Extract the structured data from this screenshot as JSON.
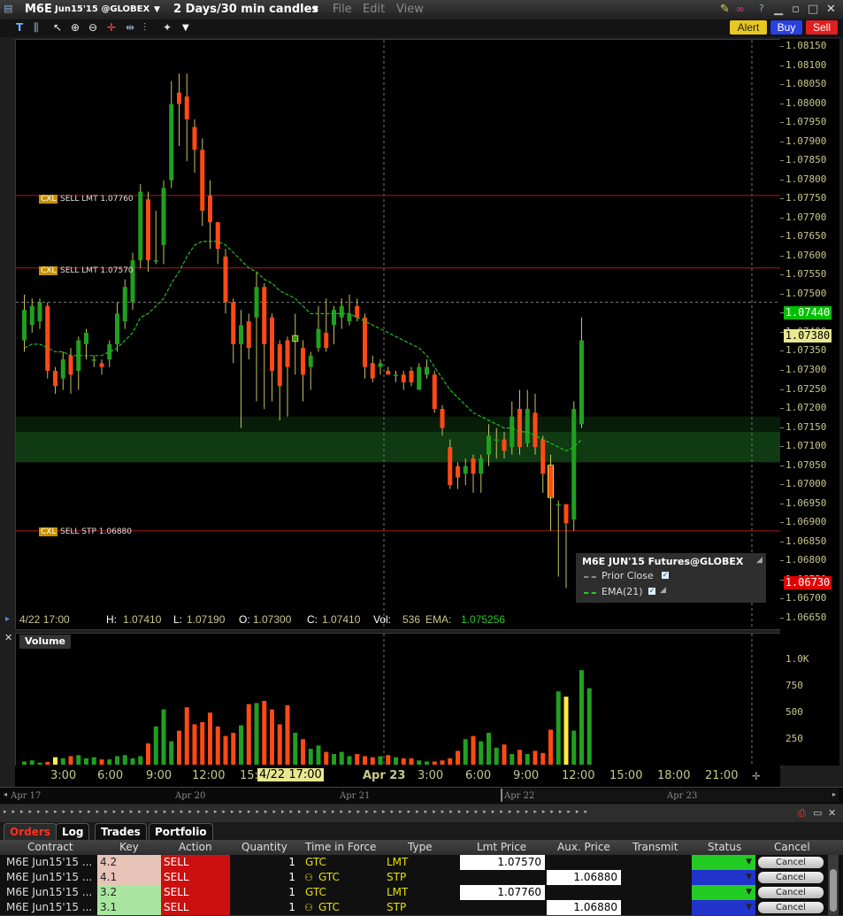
{
  "window": {
    "symbol": "M6E",
    "contract": "Jun15'15 @GLOBEX",
    "timeframe": "2 Days/30 min candles",
    "menu": [
      "File",
      "Edit",
      "View"
    ]
  },
  "header_buttons": {
    "alert": "Alert",
    "buy": "Buy",
    "sell": "Sell"
  },
  "price_axis": [
    "1.08150",
    "1.08100",
    "1.08050",
    "1.08000",
    "1.07950",
    "1.07900",
    "1.07850",
    "1.07800",
    "1.07750",
    "1.07700",
    "1.07650",
    "1.07600",
    "1.07550",
    "1.07500",
    "1.07450",
    "1.07400",
    "1.07350",
    "1.07300",
    "1.07250",
    "1.07200",
    "1.07150",
    "1.07100",
    "1.07050",
    "1.07000",
    "1.06950",
    "1.06900",
    "1.06850",
    "1.06800",
    "1.06750",
    "1.06700",
    "1.06650"
  ],
  "price_markers": {
    "last": "1.07440",
    "cursor": "1.07380",
    "stop": "1.06730"
  },
  "orders_on_chart": [
    {
      "tag": "CXL",
      "label": "SELL LMT 1.07760"
    },
    {
      "tag": "CXL",
      "label": "SELL LMT 1.07570"
    },
    {
      "tag": "CXL",
      "label": "SELL STP 1.06880"
    }
  ],
  "legend": {
    "title": "M6E JUN'15 Futures@GLOBEX",
    "items": [
      "Prior Close",
      "EMA(21)"
    ]
  },
  "info_line": {
    "time": "4/22 17:00",
    "h_label": "H:",
    "h": "1.07410",
    "l_label": "L:",
    "l": "1.07190",
    "o_label": "O:",
    "o": "1.07300",
    "c_label": "C:",
    "c": "1.07410",
    "vol_label": "Vol:",
    "vol": "536",
    "ema_label": "EMA:",
    "ema": "1.075256"
  },
  "volume_panel": {
    "title": "Volume",
    "axis": [
      "1.0K",
      "750",
      "500",
      "250"
    ]
  },
  "time_axis": [
    "3:00",
    "6:00",
    "9:00",
    "12:00",
    "15:",
    "4/22 17:00",
    "Apr 23",
    "3:00",
    "6:00",
    "9:00",
    "12:00",
    "15:00",
    "18:00",
    "21:00"
  ],
  "nav_dates": [
    "Apr 17",
    "Apr 20",
    "Apr 21",
    "Apr 22",
    "Apr 23"
  ],
  "tabs": [
    "Orders",
    "Log",
    "Trades",
    "Portfolio"
  ],
  "order_columns": [
    "Contract",
    "Key",
    "Action",
    "Quantity",
    "Time in Force",
    "Type",
    "Lmt Price",
    "Aux. Price",
    "Transmit",
    "Status",
    "Cancel"
  ],
  "orders": [
    {
      "contract": "M6E Jun15'15 ...",
      "key": "4.2",
      "action": "SELL",
      "qty": "1",
      "tif": "GTC",
      "type": "LMT",
      "lmt": "1.07570",
      "aux": "",
      "cancel": "Cancel",
      "status_color": "#22cc22",
      "key_color": "#e8c4b8"
    },
    {
      "contract": "M6E Jun15'15 ...",
      "key": "4.1",
      "action": "SELL",
      "qty": "1",
      "tif": "GTC",
      "type": "STP",
      "lmt": "",
      "aux": "1.06880",
      "cancel": "Cancel",
      "status_color": "#2233cc",
      "key_color": "#e8c4b8"
    },
    {
      "contract": "M6E Jun15'15 ...",
      "key": "3.2",
      "action": "SELL",
      "qty": "1",
      "tif": "GTC",
      "type": "LMT",
      "lmt": "1.07760",
      "aux": "",
      "cancel": "Cancel",
      "status_color": "#22cc22",
      "key_color": "#a8e6a0"
    },
    {
      "contract": "M6E Jun15'15 ...",
      "key": "3.1",
      "action": "SELL",
      "qty": "1",
      "tif": "GTC",
      "type": "STP",
      "lmt": "",
      "aux": "1.06880",
      "cancel": "Cancel",
      "status_color": "#2233cc",
      "key_color": "#a8e6a0"
    }
  ],
  "colors": {
    "up": "#1fa01f",
    "down": "#ff4a14",
    "ema": "#22bb22",
    "order_line": "#b01818",
    "axis_text": "#c8c88c"
  },
  "chart_data": {
    "type": "candlestick",
    "ylim": [
      1.0663,
      1.0818
    ],
    "ema_period": 21,
    "lines": {
      "sell_lmt_1": 1.0776,
      "sell_lmt_2": 1.0757,
      "sell_stp": 1.0688,
      "prior_close": 1.0748
    },
    "candles": [
      {
        "o": 1.0738,
        "c": 1.0746,
        "h": 1.075,
        "l": 1.0735
      },
      {
        "o": 1.0742,
        "c": 1.0747,
        "h": 1.0749,
        "l": 1.074
      },
      {
        "o": 1.0743,
        "c": 1.0748,
        "h": 1.0749,
        "l": 1.0741
      },
      {
        "o": 1.0747,
        "c": 1.073,
        "h": 1.0748,
        "l": 1.0728
      },
      {
        "o": 1.073,
        "c": 1.0726,
        "h": 1.0731,
        "l": 1.0724
      },
      {
        "o": 1.0728,
        "c": 1.0733,
        "h": 1.0735,
        "l": 1.0725
      },
      {
        "o": 1.0734,
        "c": 1.0729,
        "h": 1.0736,
        "l": 1.0724
      },
      {
        "o": 1.073,
        "c": 1.0738,
        "h": 1.0739,
        "l": 1.0725
      },
      {
        "o": 1.0737,
        "c": 1.074,
        "h": 1.0741,
        "l": 1.0733
      },
      {
        "o": 1.0733,
        "c": 1.0733,
        "h": 1.0734,
        "l": 1.0731
      },
      {
        "o": 1.0732,
        "c": 1.0731,
        "h": 1.0733,
        "l": 1.0729
      },
      {
        "o": 1.0733,
        "c": 1.0737,
        "h": 1.0738,
        "l": 1.0731
      },
      {
        "o": 1.0737,
        "c": 1.0745,
        "h": 1.0748,
        "l": 1.0735
      },
      {
        "o": 1.0743,
        "c": 1.0752,
        "h": 1.0754,
        "l": 1.0741
      },
      {
        "o": 1.0748,
        "c": 1.0759,
        "h": 1.0761,
        "l": 1.0746
      },
      {
        "o": 1.0759,
        "c": 1.0777,
        "h": 1.0779,
        "l": 1.0757
      },
      {
        "o": 1.0775,
        "c": 1.0759,
        "h": 1.0777,
        "l": 1.0756
      },
      {
        "o": 1.0759,
        "c": 1.0759,
        "h": 1.0772,
        "l": 1.0758
      },
      {
        "o": 1.0763,
        "c": 1.0778,
        "h": 1.078,
        "l": 1.0758
      },
      {
        "o": 1.078,
        "c": 1.08,
        "h": 1.0806,
        "l": 1.0778
      },
      {
        "o": 1.0803,
        "c": 1.08,
        "h": 1.0808,
        "l": 1.0789
      },
      {
        "o": 1.0802,
        "c": 1.0796,
        "h": 1.0808,
        "l": 1.0785
      },
      {
        "o": 1.0794,
        "c": 1.0788,
        "h": 1.0796,
        "l": 1.0782
      },
      {
        "o": 1.0788,
        "c": 1.0772,
        "h": 1.0791,
        "l": 1.0768
      },
      {
        "o": 1.0776,
        "c": 1.0769,
        "h": 1.078,
        "l": 1.0762
      },
      {
        "o": 1.0769,
        "c": 1.0762,
        "h": 1.0769,
        "l": 1.0758
      },
      {
        "o": 1.076,
        "c": 1.0748,
        "h": 1.0762,
        "l": 1.0745
      },
      {
        "o": 1.0748,
        "c": 1.0737,
        "h": 1.0749,
        "l": 1.0732
      },
      {
        "o": 1.0737,
        "c": 1.0742,
        "h": 1.0746,
        "l": 1.0715
      },
      {
        "o": 1.0743,
        "c": 1.0736,
        "h": 1.0745,
        "l": 1.0733
      },
      {
        "o": 1.0744,
        "c": 1.0752,
        "h": 1.0756,
        "l": 1.0722
      },
      {
        "o": 1.0752,
        "c": 1.0737,
        "h": 1.0753,
        "l": 1.072
      },
      {
        "o": 1.0744,
        "c": 1.073,
        "h": 1.0745,
        "l": 1.0722
      },
      {
        "o": 1.0737,
        "c": 1.0726,
        "h": 1.0738,
        "l": 1.0717
      },
      {
        "o": 1.0738,
        "c": 1.0731,
        "h": 1.0739,
        "l": 1.0718
      },
      {
        "o": 1.0738,
        "c": 1.0739,
        "h": 1.0745,
        "l": 1.0729
      },
      {
        "o": 1.0736,
        "c": 1.0729,
        "h": 1.0738,
        "l": 1.0722
      },
      {
        "o": 1.0731,
        "c": 1.0734,
        "h": 1.0735,
        "l": 1.0725
      },
      {
        "o": 1.0736,
        "c": 1.0741,
        "h": 1.0747,
        "l": 1.0735
      },
      {
        "o": 1.074,
        "c": 1.0736,
        "h": 1.0749,
        "l": 1.0735
      },
      {
        "o": 1.0742,
        "c": 1.0746,
        "h": 1.0747,
        "l": 1.0737
      },
      {
        "o": 1.0744,
        "c": 1.0747,
        "h": 1.0749,
        "l": 1.0741
      },
      {
        "o": 1.0743,
        "c": 1.0745,
        "h": 1.075,
        "l": 1.0742
      },
      {
        "o": 1.0747,
        "c": 1.0744,
        "h": 1.0749,
        "l": 1.0743
      },
      {
        "o": 1.0744,
        "c": 1.0731,
        "h": 1.0745,
        "l": 1.0728
      },
      {
        "o": 1.0732,
        "c": 1.0728,
        "h": 1.0734,
        "l": 1.0727
      },
      {
        "o": 1.0731,
        "c": 1.0732,
        "h": 1.0733,
        "l": 1.0729
      },
      {
        "o": 1.073,
        "c": 1.0729,
        "h": 1.0731,
        "l": 1.0729
      },
      {
        "o": 1.0729,
        "c": 1.0729,
        "h": 1.073,
        "l": 1.0727
      },
      {
        "o": 1.0729,
        "c": 1.0727,
        "h": 1.073,
        "l": 1.0725
      },
      {
        "o": 1.073,
        "c": 1.0727,
        "h": 1.0731,
        "l": 1.0726
      },
      {
        "o": 1.0725,
        "c": 1.0731,
        "h": 1.0732,
        "l": 1.0725
      },
      {
        "o": 1.0729,
        "c": 1.0731,
        "h": 1.0733,
        "l": 1.0728
      },
      {
        "o": 1.0729,
        "c": 1.072,
        "h": 1.073,
        "l": 1.0719
      },
      {
        "o": 1.072,
        "c": 1.0715,
        "h": 1.0721,
        "l": 1.0713
      },
      {
        "o": 1.071,
        "c": 1.07,
        "h": 1.0712,
        "l": 1.0699
      },
      {
        "o": 1.0705,
        "c": 1.0702,
        "h": 1.0706,
        "l": 1.0699
      },
      {
        "o": 1.0703,
        "c": 1.0705,
        "h": 1.0707,
        "l": 1.07
      },
      {
        "o": 1.0707,
        "c": 1.0703,
        "h": 1.0708,
        "l": 1.0698
      },
      {
        "o": 1.0703,
        "c": 1.0707,
        "h": 1.0708,
        "l": 1.0698
      },
      {
        "o": 1.0708,
        "c": 1.0713,
        "h": 1.0716,
        "l": 1.0705
      },
      {
        "o": 1.0712,
        "c": 1.0712,
        "h": 1.0715,
        "l": 1.0707
      },
      {
        "o": 1.0712,
        "c": 1.0709,
        "h": 1.0714,
        "l": 1.0707
      },
      {
        "o": 1.071,
        "c": 1.0718,
        "h": 1.0722,
        "l": 1.0708
      },
      {
        "o": 1.072,
        "c": 1.071,
        "h": 1.0725,
        "l": 1.0708
      },
      {
        "o": 1.0711,
        "c": 1.072,
        "h": 1.0725,
        "l": 1.071
      },
      {
        "o": 1.0719,
        "c": 1.071,
        "h": 1.0724,
        "l": 1.0708
      },
      {
        "o": 1.0712,
        "c": 1.0703,
        "h": 1.0713,
        "l": 1.0698
      },
      {
        "o": 1.0705,
        "c": 1.0697,
        "h": 1.0708,
        "l": 1.0688
      },
      {
        "o": 1.0695,
        "c": 1.0695,
        "h": 1.0696,
        "l": 1.0676
      },
      {
        "o": 1.0695,
        "c": 1.069,
        "h": 1.0695,
        "l": 1.0673
      },
      {
        "o": 1.0691,
        "c": 1.072,
        "h": 1.0722,
        "l": 1.0688
      },
      {
        "o": 1.0716,
        "c": 1.0738,
        "h": 1.0744,
        "l": 1.0715
      }
    ],
    "ema": [
      1.0736,
      1.0737,
      1.0737,
      1.0736,
      1.0735,
      1.0735,
      1.0734,
      1.0734,
      1.0734,
      1.0734,
      1.0734,
      1.0735,
      1.0736,
      1.0738,
      1.074,
      1.0744,
      1.0745,
      1.0747,
      1.0749,
      1.0753,
      1.0756,
      1.076,
      1.0763,
      1.0764,
      1.0764,
      1.0764,
      1.0763,
      1.0761,
      1.0759,
      1.0757,
      1.0756,
      1.0754,
      1.0753,
      1.0751,
      1.075,
      1.0749,
      1.0747,
      1.0745,
      1.0745,
      1.0745,
      1.0745,
      1.0745,
      1.0745,
      1.0744,
      1.0743,
      1.0742,
      1.0741,
      1.074,
      1.0739,
      1.0738,
      1.0737,
      1.0736,
      1.0734,
      1.0731,
      1.0728,
      1.0725,
      1.0723,
      1.0721,
      1.0719,
      1.0718,
      1.0717,
      1.0716,
      1.0715,
      1.0715,
      1.0714,
      1.0714,
      1.0713,
      1.0712,
      1.0711,
      1.071,
      1.0709,
      1.071,
      1.0712
    ],
    "volume": [
      30,
      40,
      20,
      25,
      70,
      60,
      80,
      90,
      60,
      70,
      50,
      50,
      80,
      90,
      60,
      80,
      200,
      360,
      520,
      220,
      320,
      540,
      380,
      400,
      490,
      360,
      270,
      300,
      370,
      570,
      580,
      600,
      520,
      380,
      560,
      300,
      240,
      150,
      180,
      120,
      100,
      120,
      80,
      100,
      80,
      70,
      80,
      90,
      70,
      60,
      60,
      40,
      30,
      30,
      40,
      60,
      130,
      240,
      270,
      220,
      300,
      160,
      190,
      100,
      140,
      100,
      130,
      110,
      330,
      690,
      640,
      320,
      890,
      720
    ]
  }
}
